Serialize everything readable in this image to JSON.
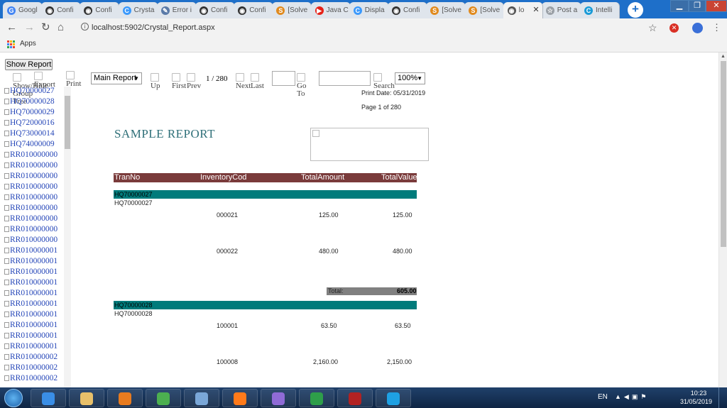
{
  "browser": {
    "tabs": [
      {
        "label": "Googl",
        "icon": "google-icon",
        "color": "#4285f4",
        "glyph": "G"
      },
      {
        "label": "Confi",
        "icon": "site-icon",
        "color": "#333333",
        "glyph": "◉"
      },
      {
        "label": "Confi",
        "icon": "site-icon",
        "color": "#333333",
        "glyph": "◉"
      },
      {
        "label": "Crysta",
        "icon": "crystal-icon",
        "color": "#3b99fc",
        "glyph": "C"
      },
      {
        "label": "Error i",
        "icon": "error-icon",
        "color": "#5a7aa8",
        "glyph": "✎"
      },
      {
        "label": "Confi",
        "icon": "site-icon",
        "color": "#333333",
        "glyph": "◉"
      },
      {
        "label": "Confi",
        "icon": "site-icon",
        "color": "#333333",
        "glyph": "◉"
      },
      {
        "label": "[Solve",
        "icon": "forum-icon",
        "color": "#e08a1e",
        "glyph": "S"
      },
      {
        "label": "Java C",
        "icon": "youtube-icon",
        "color": "#e62117",
        "glyph": "▶"
      },
      {
        "label": "Displa",
        "icon": "crystal-icon",
        "color": "#3b99fc",
        "glyph": "C"
      },
      {
        "label": "Confi",
        "icon": "site-icon",
        "color": "#333333",
        "glyph": "◉"
      },
      {
        "label": "[Solve",
        "icon": "forum-icon",
        "color": "#e08a1e",
        "glyph": "S"
      },
      {
        "label": "[Solve",
        "icon": "forum-icon",
        "color": "#e08a1e",
        "glyph": "S"
      },
      {
        "label": "lo",
        "icon": "globe-icon",
        "color": "#555555",
        "glyph": "◉",
        "active": true
      },
      {
        "label": "Post a",
        "icon": "star-icon",
        "color": "#9aa0a6",
        "glyph": "☆"
      },
      {
        "label": "Intelli",
        "icon": "intellisense-icon",
        "color": "#1a9bd7",
        "glyph": "C"
      }
    ],
    "url": "localhost:5902/Crystal_Report.aspx",
    "bookmarks_label": "Apps"
  },
  "report": {
    "show_report_label": "Show Report",
    "toolbar": {
      "show_group_tree": "Show/Hide Group Tree",
      "export": "Export",
      "print": "Print",
      "report_select": "Main Report",
      "up": "Up",
      "first": "First",
      "prev": "Prev",
      "page_indicator": "1 / 280",
      "next": "Next",
      "last": "Last",
      "goto": "Go To",
      "search": "Search",
      "zoom": "100%"
    },
    "group_tree": [
      "HQ70000027",
      "HQ70000028",
      "HQ70000029",
      "HQ72000016",
      "HQ73000014",
      "HQ74000009",
      "RR010000000",
      "RR010000000",
      "RR010000000",
      "RR010000000",
      "RR010000000",
      "RR010000000",
      "RR010000000",
      "RR010000000",
      "RR010000000",
      "RR010000001",
      "RR010000001",
      "RR010000001",
      "RR010000001",
      "RR010000001",
      "RR010000001",
      "RR010000001",
      "RR010000001",
      "RR010000001",
      "RR010000001",
      "RR010000002",
      "RR010000002",
      "RR010000002"
    ],
    "print_date_label": "Print Date:",
    "print_date_value": "05/31/2019",
    "page_label": "Page 1 of 280",
    "title": "SAMPLE REPORT",
    "columns": [
      "TranNo",
      "InventoryCod",
      "TotalAmount",
      "TotalValue"
    ],
    "groups": [
      {
        "header": "HQ70000027",
        "subheader": "HQ70000027",
        "rows": [
          {
            "code": "000021",
            "amount": "125.00",
            "value": "125.00"
          },
          {
            "code": "000022",
            "amount": "480.00",
            "value": "480.00"
          }
        ],
        "total_label": "Total:",
        "total_value": "605.00"
      },
      {
        "header": "HQ70000028",
        "subheader": "HQ70000028",
        "rows": [
          {
            "code": "100001",
            "amount": "63.50",
            "value": "63.50"
          },
          {
            "code": "100008",
            "amount": "2,160.00",
            "value": "2,150.00"
          }
        ]
      }
    ],
    "colors": {
      "header_bg": "#7a3b3b",
      "group_bg": "#007b7b",
      "total_bg": "#808080",
      "title": "#2e6f78"
    }
  },
  "taskbar": {
    "language": "EN",
    "time": "10:23",
    "date": "31/05/2019",
    "apps": [
      {
        "name": "ie-icon",
        "color": "#3a8ee6"
      },
      {
        "name": "file-explorer-icon",
        "color": "#e8c06a"
      },
      {
        "name": "media-player-icon",
        "color": "#e87b1f"
      },
      {
        "name": "chrome-icon",
        "color": "#4caf50"
      },
      {
        "name": "remote-desktop-icon",
        "color": "#7aa7d8"
      },
      {
        "name": "firefox-icon",
        "color": "#ff7a1a"
      },
      {
        "name": "visual-studio-icon",
        "color": "#8f6bd6"
      },
      {
        "name": "green-app-icon",
        "color": "#2e9e4a"
      },
      {
        "name": "flag-app-icon",
        "color": "#b22222"
      },
      {
        "name": "skype-icon",
        "color": "#1ea0e3"
      }
    ]
  }
}
